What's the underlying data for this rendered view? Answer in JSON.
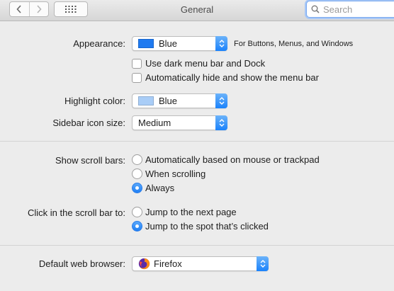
{
  "window": {
    "title": "General"
  },
  "search": {
    "placeholder": "Search"
  },
  "appearance": {
    "label": "Appearance:",
    "value": "Blue",
    "swatch_color": "#1f7af0",
    "hint": "For Buttons, Menus, and Windows"
  },
  "options": {
    "dark_menu": {
      "label": "Use dark menu bar and Dock",
      "checked": false
    },
    "auto_hide": {
      "label": "Automatically hide and show the menu bar",
      "checked": false
    }
  },
  "highlight": {
    "label": "Highlight color:",
    "value": "Blue",
    "swatch_color": "#a9cdf7"
  },
  "sidebar_icon_size": {
    "label": "Sidebar icon size:",
    "value": "Medium"
  },
  "scroll_bars": {
    "label": "Show scroll bars:",
    "options": [
      {
        "label": "Automatically based on mouse or trackpad",
        "selected": false
      },
      {
        "label": "When scrolling",
        "selected": false
      },
      {
        "label": "Always",
        "selected": true
      }
    ]
  },
  "scroll_click": {
    "label": "Click in the scroll bar to:",
    "options": [
      {
        "label": "Jump to the next page",
        "selected": false
      },
      {
        "label": "Jump to the spot that’s clicked",
        "selected": true
      }
    ]
  },
  "browser": {
    "label": "Default web browser:",
    "value": "Firefox",
    "icon": "firefox-icon"
  },
  "colors": {
    "accent": "#1a82fb",
    "background": "#ececec"
  }
}
